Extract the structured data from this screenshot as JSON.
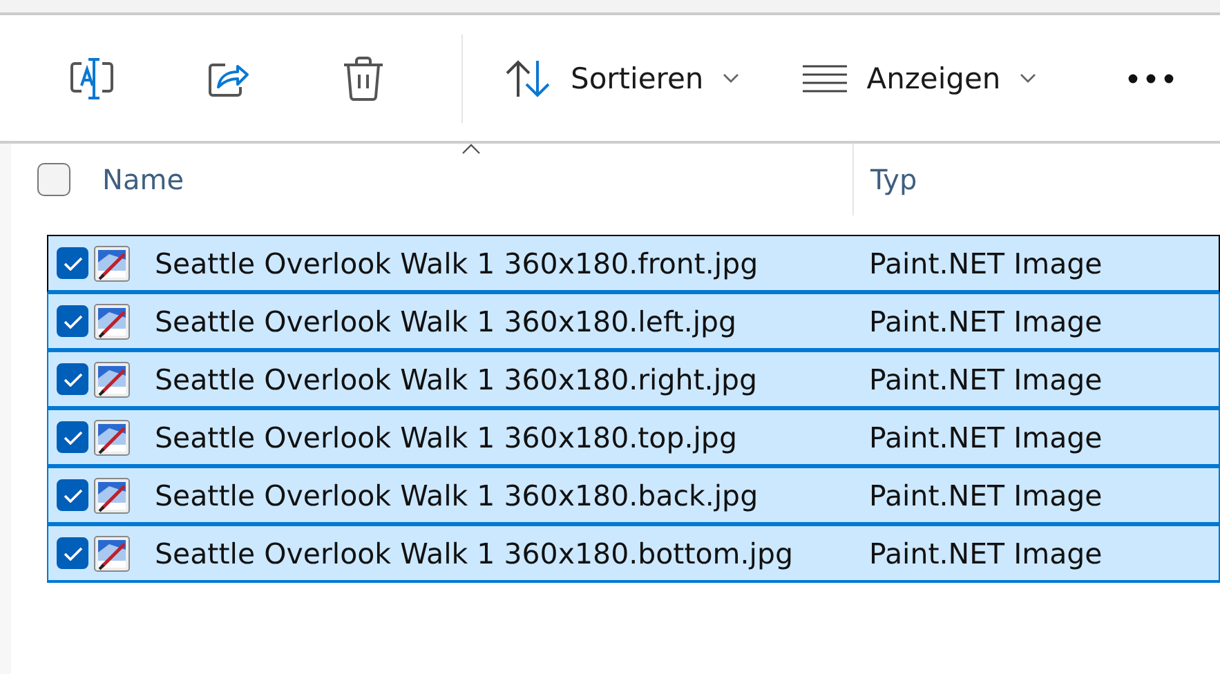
{
  "toolbar": {
    "actions": [
      {
        "kind": "rename"
      },
      {
        "kind": "share"
      },
      {
        "kind": "delete"
      }
    ],
    "menus": [
      {
        "kind": "sort",
        "label": "Sortieren"
      },
      {
        "kind": "view",
        "label": "Anzeigen"
      }
    ],
    "more": {
      "kind": "more"
    }
  },
  "table": {
    "select_all": {
      "checked": false
    },
    "columns": [
      {
        "label": "Name",
        "sorted": true
      },
      {
        "label": "Typ",
        "sorted": false
      }
    ],
    "rows": [
      {
        "name": "Seattle Overlook Walk 1 360x180.front.jpg",
        "type": "Paint.NET Image",
        "selected": true,
        "focused": true
      },
      {
        "name": "Seattle Overlook Walk 1 360x180.left.jpg",
        "type": "Paint.NET Image",
        "selected": true,
        "focused": false
      },
      {
        "name": "Seattle Overlook Walk 1 360x180.right.jpg",
        "type": "Paint.NET Image",
        "selected": true,
        "focused": false
      },
      {
        "name": "Seattle Overlook Walk 1 360x180.top.jpg",
        "type": "Paint.NET Image",
        "selected": true,
        "focused": false
      },
      {
        "name": "Seattle Overlook Walk 1 360x180.back.jpg",
        "type": "Paint.NET Image",
        "selected": true,
        "focused": false
      },
      {
        "name": "Seattle Overlook Walk 1 360x180.bottom.jpg",
        "type": "Paint.NET Image",
        "selected": true,
        "focused": false
      }
    ]
  }
}
